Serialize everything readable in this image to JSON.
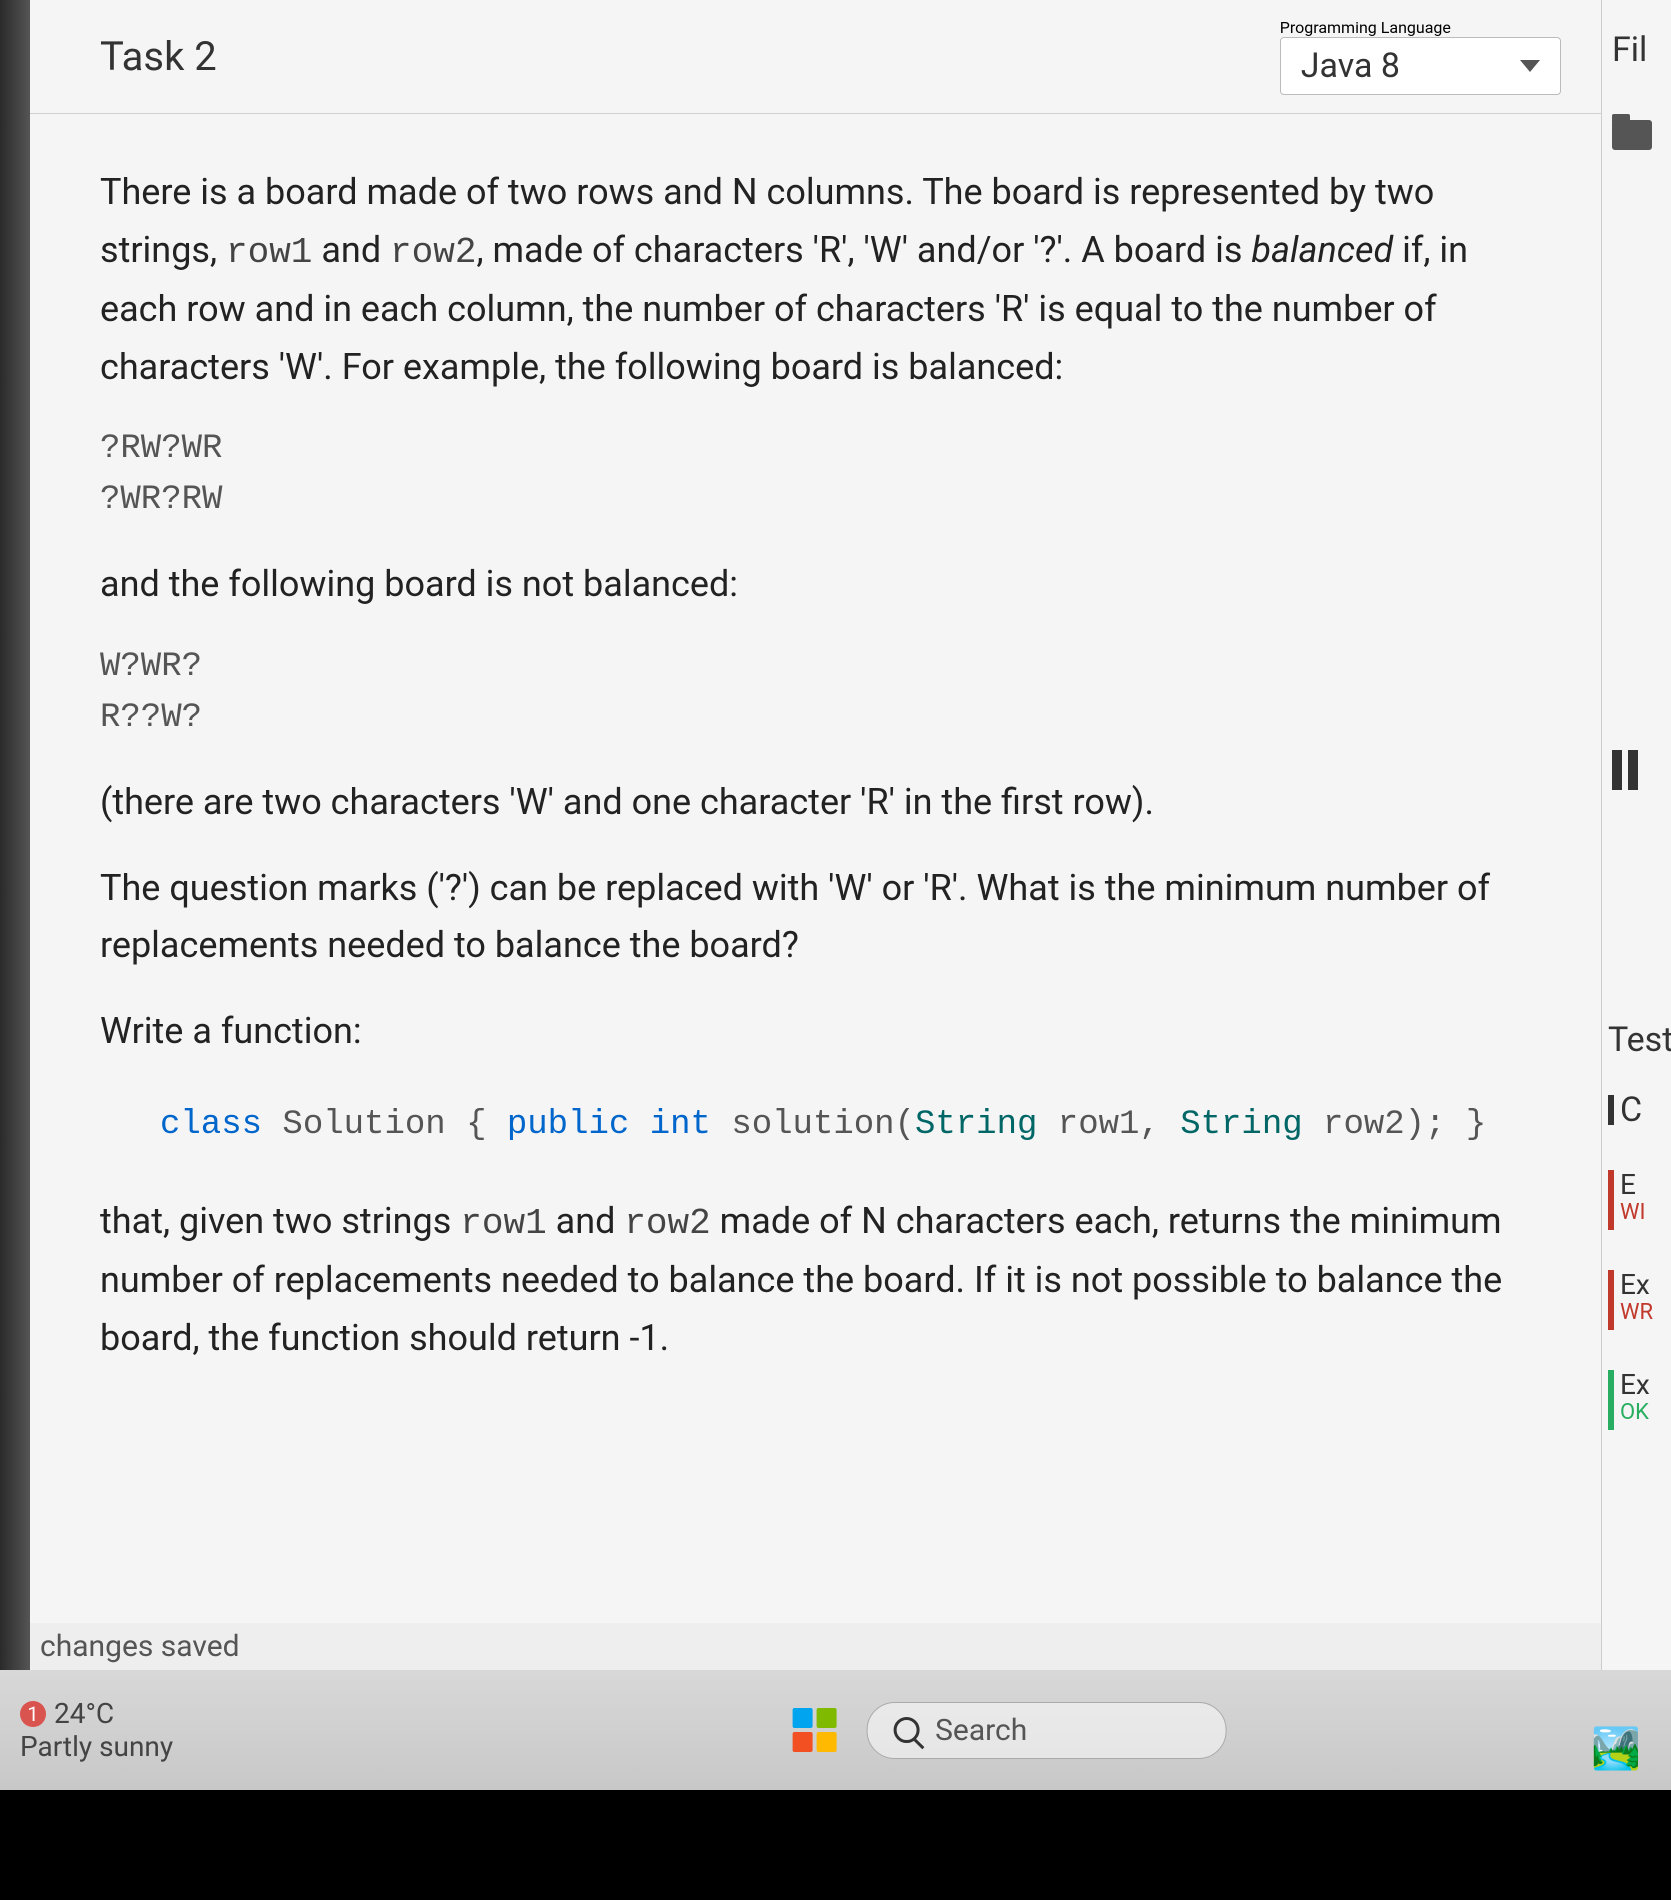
{
  "header": {
    "task_title": "Task 2",
    "lang_caption": "Programming Language",
    "lang_value": "Java 8",
    "right_label": "Fil"
  },
  "problem": {
    "p1_a": "There is a board made of two rows and N columns. The board is represented by two strings, ",
    "row1": "row1",
    "p1_b": " and ",
    "row2": "row2",
    "p1_c": ", made of characters 'R', 'W' and/or '?'. A board is ",
    "balanced_word": "balanced",
    "p1_d": " if, in each row and in each column, the number of characters 'R' is equal to the number of characters 'W'. For example, the following board is balanced:",
    "ex1_l1": "?RW?WR",
    "ex1_l2": "?WR?RW",
    "p2": "and the following board is not balanced:",
    "ex2_l1": "W?WR?",
    "ex2_l2": "R??W?",
    "p3": "(there are two characters 'W' and one character 'R' in the first row).",
    "p4": "The question marks ('?') can be replaced with 'W' or 'R'. What is the minimum number of replacements needed to balance the board?",
    "p5": "Write a function:",
    "sig_class": "class",
    "sig_name": " Solution { ",
    "sig_pub": "public",
    "sig_int": " int",
    "sig_fn": " solution(",
    "sig_string1": "String",
    "sig_arg1": " row1, ",
    "sig_string2": "String",
    "sig_arg2": " row2); }",
    "p6_a": "that, given two strings ",
    "p6_b": " and ",
    "p6_c": " made of N characters each, returns the minimum number of replacements needed to balance the board. If it is not possible to balance the board, the function should return -1."
  },
  "right_panel": {
    "test": "Test",
    "c": "C",
    "ex1": "Ex",
    "wr": "WR",
    "ex2": "Ex",
    "ok": "OK",
    "e": "E",
    "wi": "WI"
  },
  "status": {
    "changes": "changes saved"
  },
  "taskbar": {
    "badge": "1",
    "temp": "24°C",
    "weather": "Partly sunny",
    "search": "Search"
  }
}
